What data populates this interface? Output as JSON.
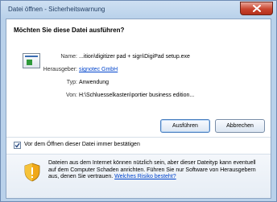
{
  "window": {
    "title": "Datei öffnen - Sicherheitswarnung"
  },
  "dialog": {
    "heading": "Möchten Sie diese Datei ausführen?",
    "fields": [
      {
        "label": "Name:",
        "value": "...ition\\digitizer pad + sign\\DigiPad setup.exe"
      },
      {
        "label": "Herausgeber:",
        "value": "signotec GmbH"
      },
      {
        "label": "Typ:",
        "value": "Anwendung"
      },
      {
        "label": "Von:",
        "value": "H:\\Schluesselkasten\\portier business edition..."
      }
    ],
    "buttons": {
      "run": "Ausführen",
      "cancel": "Abbrechen"
    },
    "checkbox": {
      "label": "Vor dem Öffnen dieser Datei immer bestätigen",
      "checked": true
    },
    "warning": {
      "text": "Dateien aus dem Internet können nützlich sein, aber dieser Dateityp kann eventuell auf dem Computer Schaden anrichten. Führen Sie nur Software von Herausgebern aus, denen Sie vertrauen.",
      "link": "Welches Risiko besteht?"
    }
  },
  "colors": {
    "link": "#0044cc",
    "close_button": "#c9452f",
    "frame": "#b9d1ea"
  },
  "icons": {
    "close": "close-icon",
    "file": "application-file-icon",
    "checkbox": "checkmark-icon",
    "warning": "security-shield-icon"
  }
}
